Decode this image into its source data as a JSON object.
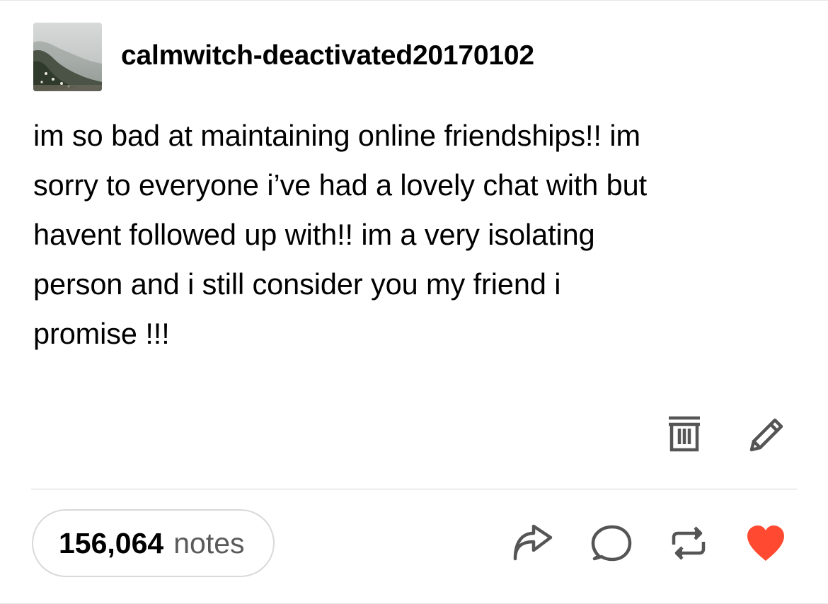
{
  "post": {
    "username": "calmwitch-deactivated20170102",
    "avatar_icon": "landscape-avatar",
    "body_lines": [
      "im so bad at maintaining online friendships!! im",
      "sorry to everyone i’ve had a lovely chat with but",
      "havent followed up with!! im a very isolating",
      "person and i still consider you my friend i",
      "promise !!!"
    ]
  },
  "owner_actions": {
    "delete_icon": "trash-icon",
    "edit_icon": "pencil-icon"
  },
  "footer": {
    "notes_count": "156,064",
    "notes_label": "notes",
    "share_icon": "share-icon",
    "reply_icon": "reply-icon",
    "reblog_icon": "reblog-icon",
    "like_icon": "heart-icon",
    "like_color": "#ff4930",
    "icon_color": "#555555"
  }
}
